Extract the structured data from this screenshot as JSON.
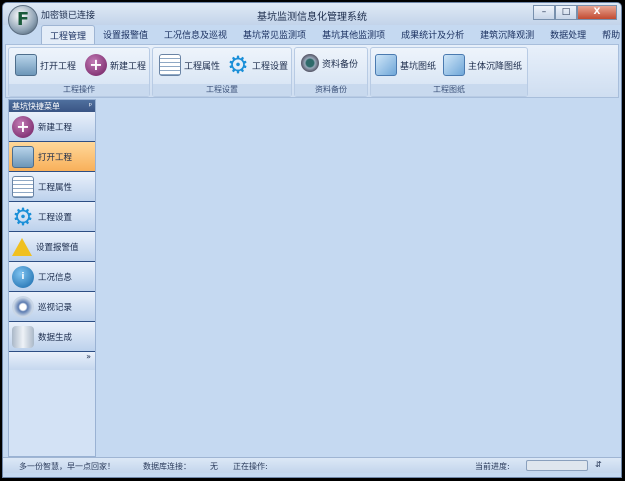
{
  "window": {
    "title": "基坑监测信息化管理系统",
    "lock_status": "加密锁已连接",
    "logo_letter": "F",
    "minimize": "–",
    "maximize": "□",
    "close": "X"
  },
  "tabs": [
    "工程管理",
    "设置报警值",
    "工况信息及巡视",
    "基坑常见监测项",
    "基坑其他监测项",
    "成果统计及分析",
    "建筑沉降观测",
    "数据处理",
    "帮助"
  ],
  "ribbon": {
    "groups": [
      {
        "label": "工程操作",
        "buttons": [
          {
            "label": "打开工程",
            "icon": "open-folder-icon"
          },
          {
            "label": "新建工程",
            "icon": "plus-circle-icon"
          }
        ]
      },
      {
        "label": "工程设置",
        "buttons": [
          {
            "label": "工程属性",
            "icon": "property-list-icon"
          },
          {
            "label": "工程设置",
            "icon": "gear-icon"
          }
        ]
      },
      {
        "label": "资料备份",
        "buttons": [
          {
            "label": "资料备份",
            "icon": "backup-icon"
          }
        ]
      },
      {
        "label": "工程图纸",
        "buttons": [
          {
            "label": "基坑图纸",
            "icon": "drawing-icon"
          },
          {
            "label": "主体沉降图纸",
            "icon": "drawing-icon"
          }
        ]
      }
    ]
  },
  "sidebar": {
    "title": "基坑快捷菜单",
    "pin": "ᵖ",
    "more": "»",
    "items": [
      {
        "label": "新建工程",
        "icon": "plus-circle-icon"
      },
      {
        "label": "打开工程",
        "icon": "open-folder-icon",
        "active": true
      },
      {
        "label": "工程属性",
        "icon": "property-list-icon"
      },
      {
        "label": "工程设置",
        "icon": "gear-icon"
      },
      {
        "label": "设置报警值",
        "icon": "warning-icon"
      },
      {
        "label": "工况信息",
        "icon": "info-icon"
      },
      {
        "label": "巡视记录",
        "icon": "camera-icon"
      },
      {
        "label": "数据生成",
        "icon": "database-icon"
      }
    ]
  },
  "status": {
    "slogan": "多一份智慧，早一点回家！",
    "db_label": "数据库连接：",
    "db_value": "无",
    "op_label": "正在操作:",
    "progress_label": "当前进度:",
    "progress": 0
  }
}
